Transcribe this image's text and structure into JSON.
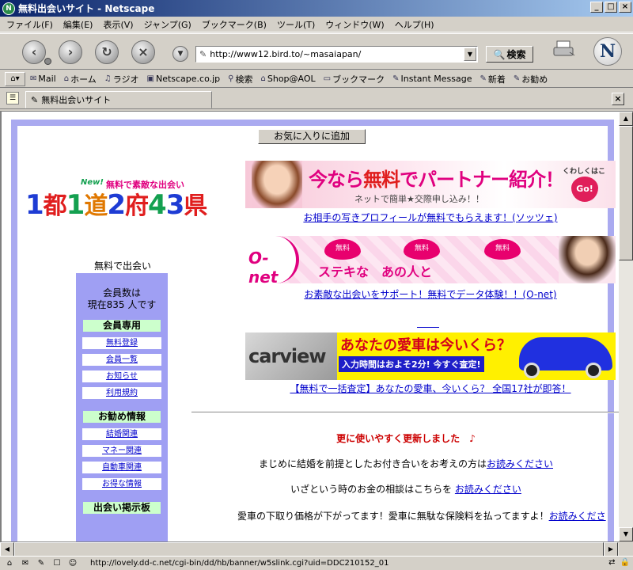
{
  "window": {
    "title": "無料出会いサイト - Netscape",
    "minimize": "_",
    "maximize": "□",
    "close": "×"
  },
  "menu": [
    "ファイル(F)",
    "編集(E)",
    "表示(V)",
    "ジャンプ(G)",
    "ブックマーク(B)",
    "ツール(T)",
    "ウィンドウ(W)",
    "ヘルプ(H)"
  ],
  "navigation": {
    "url": "http://www12.bird.to/~masaiapan/",
    "search_label": "検索"
  },
  "personal_toolbar": [
    {
      "icon": "mail-icon",
      "label": "Mail"
    },
    {
      "icon": "home-icon",
      "label": "ホーム"
    },
    {
      "icon": "radio-icon",
      "label": "ラジオ"
    },
    {
      "icon": "my-icon",
      "label": "Netscape.co.jp"
    },
    {
      "icon": "search-icon",
      "label": "検索"
    },
    {
      "icon": "shop-icon",
      "label": "Shop@AOL"
    },
    {
      "icon": "folder-icon",
      "label": "ブックマーク"
    },
    {
      "icon": "bookmark-icon",
      "label": "Instant Message"
    },
    {
      "icon": "bookmark-icon",
      "label": "新着"
    },
    {
      "icon": "bookmark-icon",
      "label": "お勧め"
    }
  ],
  "tab": {
    "title": "無料出会いサイト"
  },
  "page": {
    "favorite_button": "お気に入りに追加",
    "logo": {
      "new": "New!",
      "tagline": "無料で素敵な出会い",
      "main": "1都1道2府43県"
    },
    "free_label": "無料で出会い",
    "member_count_line1": "会員数は",
    "member_count_line2": "現在835 人です",
    "sections": [
      {
        "title": "会員専用",
        "items": [
          "無料登録",
          "会員一覧",
          "お知らせ",
          "利用規約"
        ]
      },
      {
        "title": "お勧め情報",
        "items": [
          "結婚関連",
          "マネー関連",
          "自動車関連",
          "お得な情報"
        ]
      },
      {
        "title": "出会い掲示板",
        "items": []
      }
    ],
    "banners": [
      {
        "headline_a": "今なら",
        "headline_b": "無料",
        "headline_c": "で",
        "headline_d": "パートナー紹介！",
        "sub": "ネットで簡単★交際申し込み！！",
        "badge_small": "くわしくはこちら",
        "badge_go": "Go!",
        "link": "お相手の写きプロフィールが無料でもらえます！(ソッツェ)"
      },
      {
        "logo": "O-net",
        "hearts": [
          "無料",
          "無料",
          "無料"
        ],
        "text": "ステキな　あの人と",
        "link": "お素敵な出会いをサポート！無料でデータ体験！！(O-net)"
      },
      {
        "logo": "carview",
        "headline": "あなたの愛車は今いくら？",
        "sub": "入力時間はおよそ2分!  今すぐ査定!",
        "link": "【無料で一括査定】あなたの愛車、今いくら？ 全国17社が即答！"
      }
    ],
    "update_heading": "更に使いやすく更新しました　♪",
    "info_lines": [
      {
        "text": "まじめに結婚を前提としたお付き合いをお考えの方は",
        "link": "お読みください"
      },
      {
        "text": "いざという時のお金の相談はこちらを ",
        "link": "お読みください"
      },
      {
        "text": "愛車の下取り価格が下がってます！愛車に無駄な保険料を払ってますよ！",
        "link": "お読みくださ"
      }
    ]
  },
  "status": {
    "url": "http://lovely.dd-c.net/cgi-bin/dd/hb/banner/w5slink.cgi?uid=DDC210152_01"
  },
  "colors": {
    "sidebar_bg": "#9f9ff3",
    "frame_border": "#aaaaf0",
    "section_head_bg": "#ccffcc",
    "link": "#0000cc",
    "update_heading": "#cc0000"
  }
}
